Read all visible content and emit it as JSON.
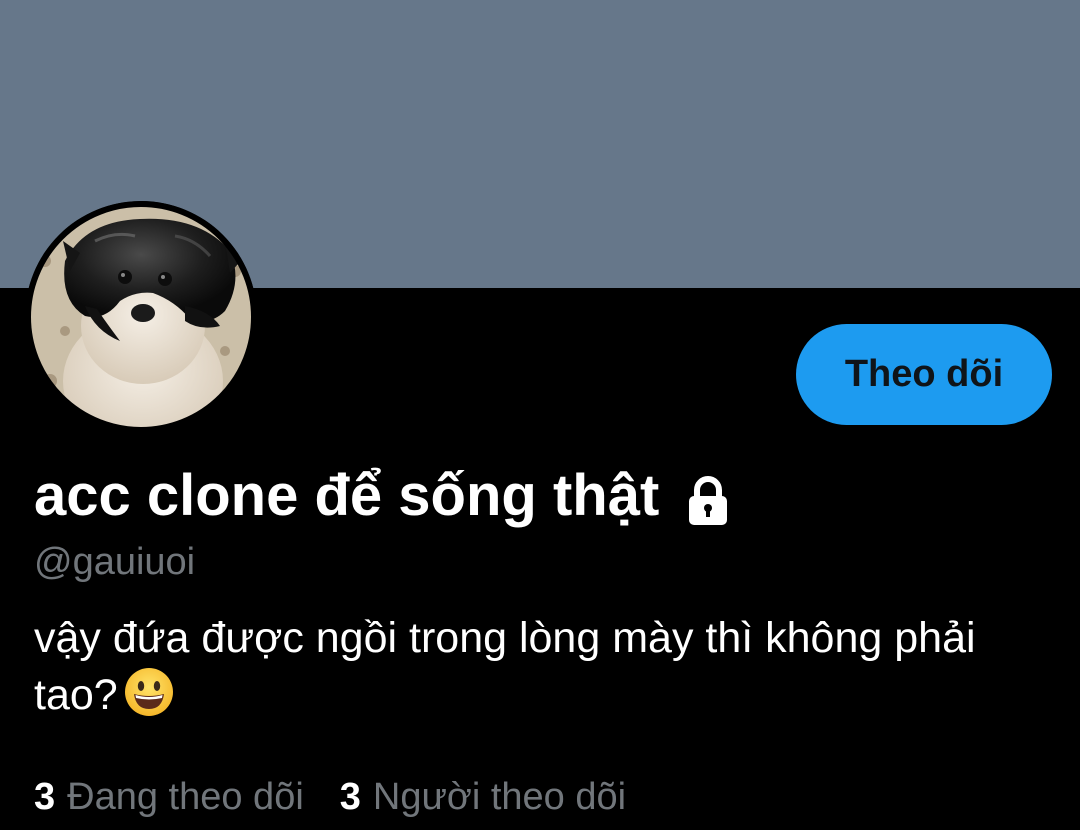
{
  "profile": {
    "display_name": "acc clone để sống thật",
    "handle": "@gauiuoi",
    "bio": "vậy đứa được ngồi trong lòng mày thì không phải tao?",
    "bio_emoji": "grinning-face-emoji",
    "protected_icon": "lock-icon",
    "avatar_icon": "dog-with-bag-avatar"
  },
  "actions": {
    "follow_label": "Theo dõi"
  },
  "stats": {
    "following_count": "3",
    "following_label": "Đang theo dõi",
    "followers_count": "3",
    "followers_label": "Người theo dõi"
  },
  "colors": {
    "banner": "#66778a",
    "background": "#000000",
    "accent": "#1d9bf0",
    "secondary_text": "#71767b"
  }
}
